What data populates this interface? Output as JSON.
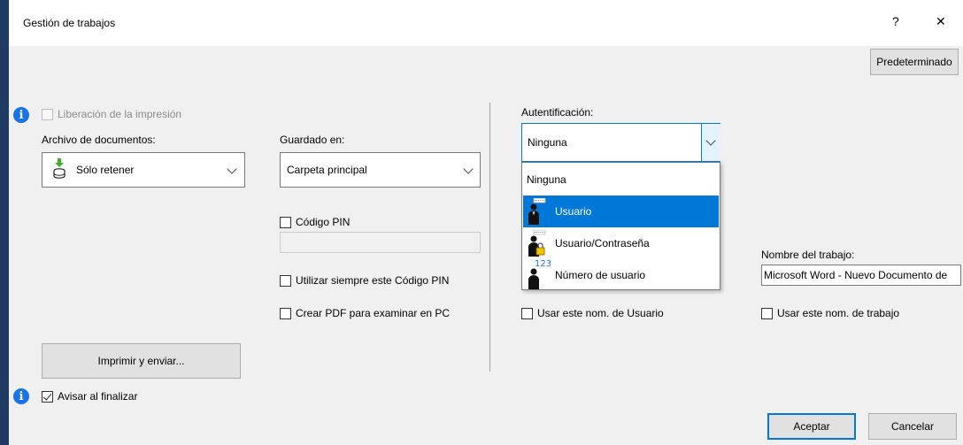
{
  "window": {
    "title": "Gestión de trabajos",
    "help_label": "?",
    "close_label": "✕"
  },
  "toolbar": {
    "default_label": "Predeterminado"
  },
  "release": {
    "label": "Liberación de la impresión",
    "checked": false,
    "enabled": false
  },
  "document_filing": {
    "label": "Archivo de documentos:",
    "value": "Sólo retener"
  },
  "save_to": {
    "label": "Guardado en:",
    "value": "Carpeta principal"
  },
  "pin": {
    "label": "Código PIN",
    "value": ""
  },
  "always_pin": {
    "label": "Utilizar siempre este Código PIN"
  },
  "create_pdf": {
    "label": "Crear PDF para examinar en PC"
  },
  "authentication": {
    "label": "Autentificación:",
    "value": "Ninguna",
    "options": [
      {
        "label": "Ninguna",
        "icon": ""
      },
      {
        "label": "Usuario",
        "icon": "user-icon",
        "selected": true
      },
      {
        "label": "Usuario/Contraseña",
        "icon": "user-lock-icon"
      },
      {
        "label": "Número de usuario",
        "icon": "user-number-icon",
        "badge": "123"
      }
    ]
  },
  "use_user_name": {
    "label": "Usar este nom. de Usuario"
  },
  "job_name": {
    "label": "Nombre del trabajo:",
    "value": "Microsoft Word - Nuevo Documento de"
  },
  "use_job_name": {
    "label": "Usar este nom. de trabajo"
  },
  "print_send": {
    "label": "Imprimir y enviar..."
  },
  "notify": {
    "label": "Avisar al finalizar",
    "checked": true
  },
  "footer": {
    "ok_label": "Aceptar",
    "cancel_label": "Cancelar"
  },
  "colors": {
    "accent": "#0078d7",
    "info": "#1a73e8"
  }
}
